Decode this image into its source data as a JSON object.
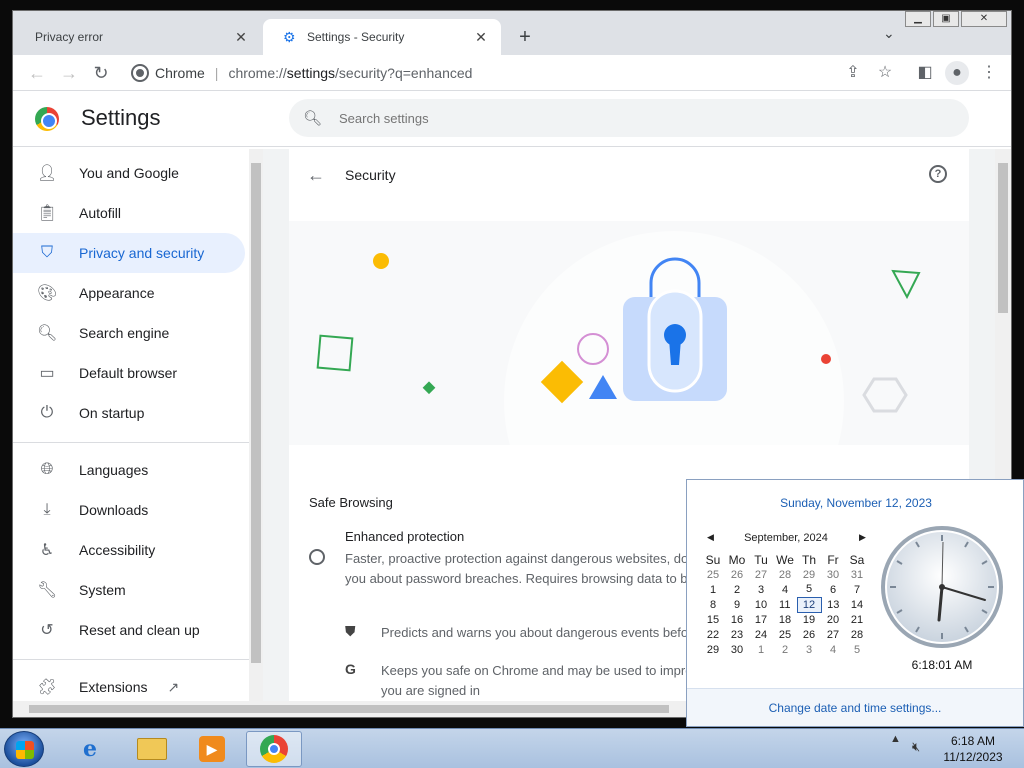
{
  "browser": {
    "tabs": [
      {
        "title": "Privacy error",
        "active": false
      },
      {
        "title": "Settings - Security",
        "active": true
      }
    ],
    "url_site": "Chrome",
    "url_prefix": "chrome://",
    "url_host": "settings",
    "url_path": "/security?q=enhanced"
  },
  "settings": {
    "title": "Settings",
    "search_placeholder": "Search settings",
    "nav": [
      {
        "label": "You and Google",
        "icon": "person-icon"
      },
      {
        "label": "Autofill",
        "icon": "clipboard-icon"
      },
      {
        "label": "Privacy and security",
        "icon": "shield-icon",
        "active": true
      },
      {
        "label": "Appearance",
        "icon": "palette-icon"
      },
      {
        "label": "Search engine",
        "icon": "search-icon"
      },
      {
        "label": "Default browser",
        "icon": "browser-icon"
      },
      {
        "label": "On startup",
        "icon": "power-icon"
      },
      {
        "label": "Languages",
        "icon": "globe-icon"
      },
      {
        "label": "Downloads",
        "icon": "download-icon"
      },
      {
        "label": "Accessibility",
        "icon": "accessibility-icon"
      },
      {
        "label": "System",
        "icon": "wrench-icon"
      },
      {
        "label": "Reset and clean up",
        "icon": "history-icon"
      },
      {
        "label": "Extensions",
        "icon": "puzzle-icon"
      }
    ]
  },
  "security": {
    "title": "Security",
    "safe_browsing_title": "Safe Browsing",
    "enhanced_title": "Enhanced protection",
    "enhanced_desc": "Faster, proactive protection against dangerous websites, do you about password breaches. Requires browsing data to be",
    "bullet1": "Predicts and warns you about dangerous events befo",
    "bullet2": "Keeps you safe on Chrome and may be used to impro you are signed in"
  },
  "popup": {
    "today": "Sunday, November 12, 2023",
    "month_label": "September, 2024",
    "weekdays": [
      "Su",
      "Mo",
      "Tu",
      "We",
      "Th",
      "Fr",
      "Sa"
    ],
    "weeks": [
      [
        "25",
        "26",
        "27",
        "28",
        "29",
        "30",
        "31"
      ],
      [
        "1",
        "2",
        "3",
        "4",
        "5",
        "6",
        "7"
      ],
      [
        "8",
        "9",
        "10",
        "11",
        "12",
        "13",
        "14"
      ],
      [
        "15",
        "16",
        "17",
        "18",
        "19",
        "20",
        "21"
      ],
      [
        "22",
        "23",
        "24",
        "25",
        "26",
        "27",
        "28"
      ],
      [
        "29",
        "30",
        "1",
        "2",
        "3",
        "4",
        "5"
      ]
    ],
    "selected_day": "12",
    "time": "6:18:01 AM",
    "footer_link": "Change date and time settings..."
  },
  "taskbar": {
    "time": "6:18 AM",
    "date": "11/12/2023"
  }
}
